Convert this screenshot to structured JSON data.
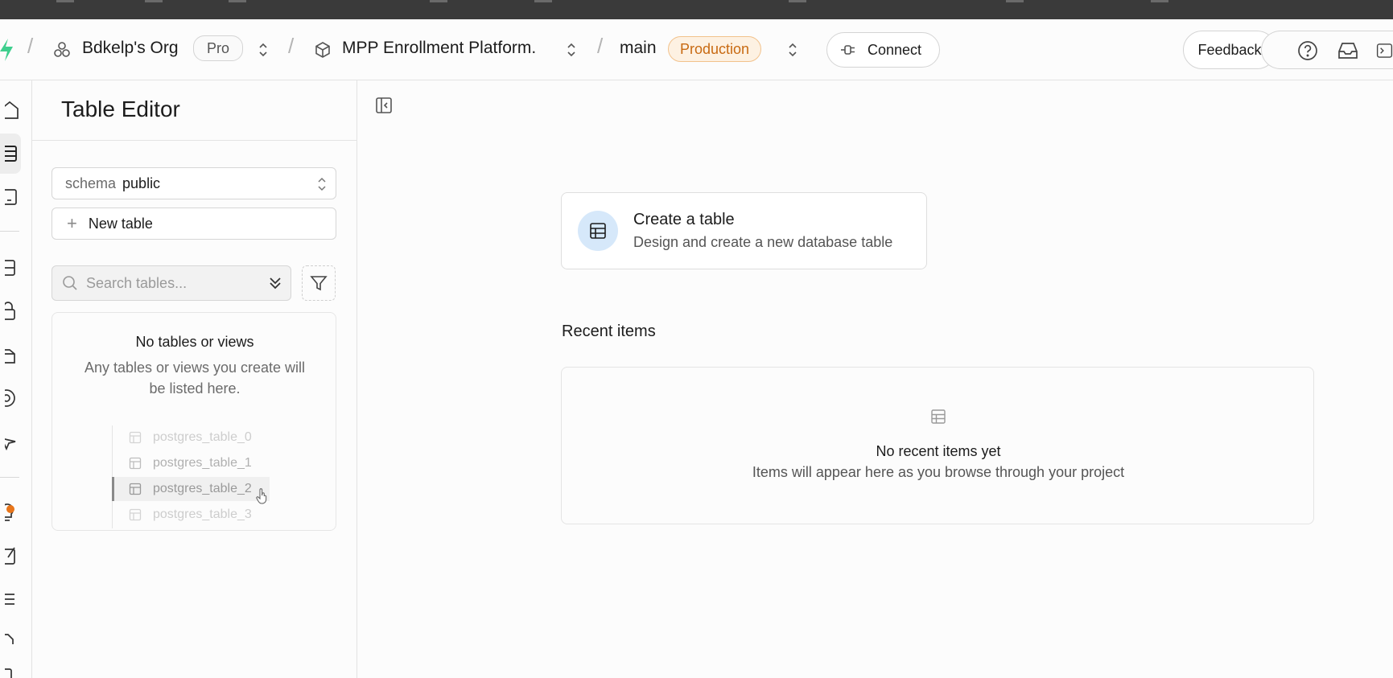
{
  "header": {
    "org_name": "Bdkelp's Org",
    "plan_badge": "Pro",
    "project_name": "MPP Enrollment Platform.",
    "branch_name": "main",
    "environment_badge": "Production",
    "connect_label": "Connect",
    "feedback_label": "Feedback",
    "separator": "/"
  },
  "sidebar": {
    "title": "Table Editor",
    "schema_label": "schema",
    "schema_value": "public",
    "new_table_label": "New table",
    "search_placeholder": "Search tables...",
    "empty_title": "No tables or views",
    "empty_description": "Any tables or views you create will be listed here.",
    "ghost_tables": [
      "postgres_table_0",
      "postgres_table_1",
      "postgres_table_2",
      "postgres_table_3"
    ]
  },
  "main": {
    "create_title": "Create a table",
    "create_subtitle": "Design and create a new database table",
    "recent_title": "Recent items",
    "recent_empty_title": "No recent items yet",
    "recent_empty_subtitle": "Items will appear here as you browse through your project"
  },
  "colors": {
    "brand": "#3ecf8e",
    "production_text": "#c86a12",
    "production_bg": "#fdf1e2",
    "create_icon_bg": "#d6e8fa",
    "notification_dot": "#e8751a"
  },
  "icons": [
    "supabase-logo-icon",
    "org-icon",
    "project-icon",
    "chevron-updown-icon",
    "plug-icon",
    "help-icon",
    "inbox-icon",
    "terminal-icon",
    "home-icon",
    "table-icon",
    "sql-icon",
    "database-icon",
    "auth-icon",
    "storage-icon",
    "functions-icon",
    "realtime-icon",
    "advisors-icon",
    "reports-icon",
    "logs-icon",
    "docs-icon",
    "settings-icon",
    "search-icon",
    "filter-icon",
    "panel-collapse-icon"
  ]
}
